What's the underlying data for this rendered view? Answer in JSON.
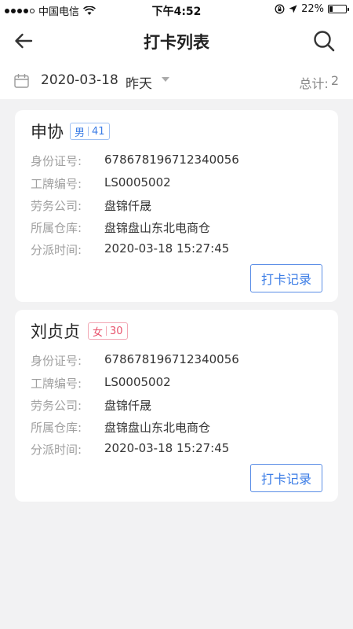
{
  "status_bar": {
    "carrier": "中国电信",
    "time": "下午4:52",
    "battery_text": "22%",
    "battery_level": 0.22
  },
  "nav": {
    "title": "打卡列表",
    "back_icon": "arrow-left-icon",
    "search_icon": "search-icon"
  },
  "filter": {
    "date": "2020-03-18",
    "day": "昨天",
    "total_label": "总计:",
    "total_count": "2"
  },
  "labels": {
    "id_number": "身份证号:",
    "badge_no": "工牌编号:",
    "labor_company": "劳务公司:",
    "warehouse": "所属仓库:",
    "assign_time": "分派时间:"
  },
  "cards": [
    {
      "name": "申协",
      "gender": "男",
      "age": "41",
      "id_number": "678678196712340056",
      "badge_no": "LS0005002",
      "labor_company": "盘锦仟晟",
      "warehouse": "盘锦盘山东北电商仓",
      "assign_time": "2020-03-18 15:27:45",
      "button": "打卡记录"
    },
    {
      "name": "刘贞贞",
      "gender": "女",
      "age": "30",
      "id_number": "678678196712340056",
      "badge_no": "LS0005002",
      "labor_company": "盘锦仟晟",
      "warehouse": "盘锦盘山东北电商仓",
      "assign_time": "2020-03-18 15:27:45",
      "button": "打卡记录"
    }
  ],
  "colors": {
    "accent": "#3c7de6",
    "female": "#e8526c",
    "background": "#f2f2f3"
  }
}
